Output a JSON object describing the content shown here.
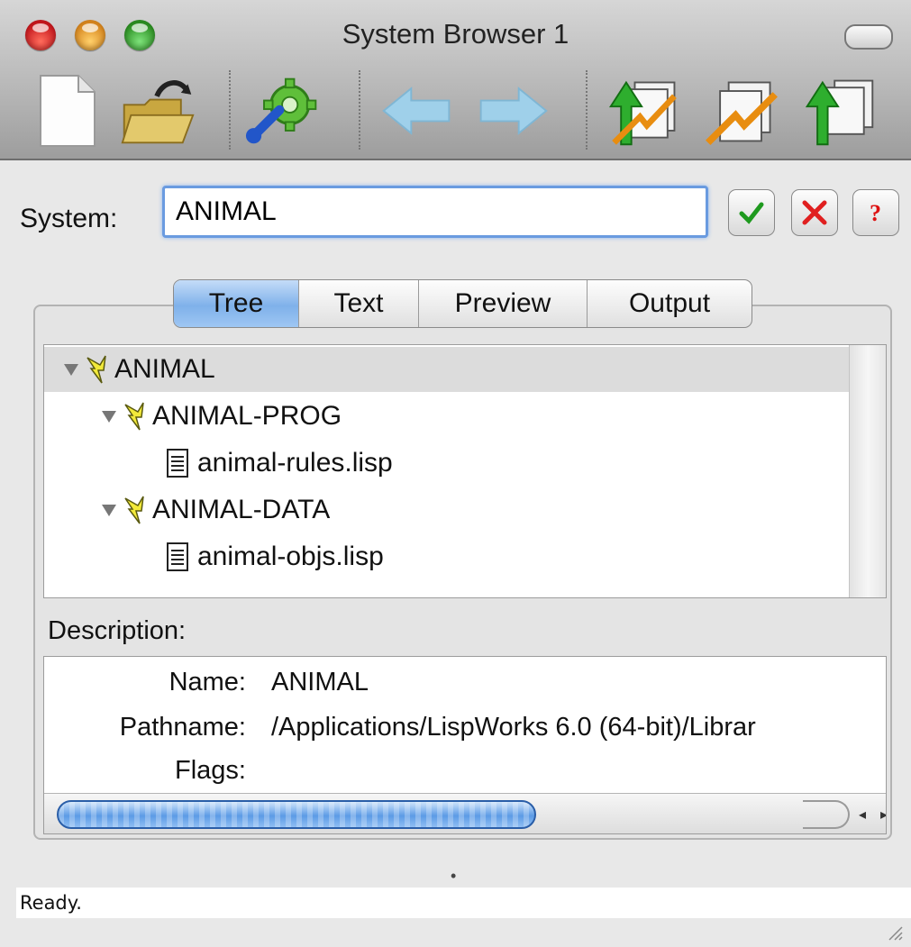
{
  "window": {
    "title": "System Browser 1"
  },
  "toolbar": {
    "buttons": [
      {
        "name": "new-document-icon"
      },
      {
        "name": "open-folder-icon"
      },
      {
        "name": "settings-tools-icon"
      },
      {
        "name": "back-arrow-icon"
      },
      {
        "name": "forward-arrow-icon"
      },
      {
        "name": "load-system-icon"
      },
      {
        "name": "compile-system-icon"
      },
      {
        "name": "upload-files-icon"
      }
    ]
  },
  "system": {
    "label": "System:",
    "value": "ANIMAL",
    "ok_icon": "checkmark-icon",
    "cancel_icon": "x-icon",
    "help_icon": "question-icon"
  },
  "tabs": [
    "Tree",
    "Text",
    "Preview",
    "Output"
  ],
  "active_tab": "Tree",
  "tree": {
    "nodes": [
      {
        "label": "ANIMAL",
        "type": "system",
        "level": 0,
        "expanded": true,
        "selected": true
      },
      {
        "label": "ANIMAL-PROG",
        "type": "system",
        "level": 1,
        "expanded": true
      },
      {
        "label": "animal-rules.lisp",
        "type": "file",
        "level": 2
      },
      {
        "label": "ANIMAL-DATA",
        "type": "system",
        "level": 1,
        "expanded": true
      },
      {
        "label": "animal-objs.lisp",
        "type": "file",
        "level": 2
      }
    ]
  },
  "description": {
    "label": "Description:",
    "rows": [
      {
        "key": "Name:",
        "value": "ANIMAL"
      },
      {
        "key": "Pathname:",
        "value": "/Applications/LispWorks 6.0 (64-bit)/Librar"
      },
      {
        "key": "Flags:",
        "value": ""
      }
    ],
    "hscroll_position": 0.0
  },
  "status": {
    "text": "Ready."
  },
  "colors": {
    "accent": "#6a9be0",
    "selected_row": "#dcdcdc",
    "system_icon_yellow": "#f2e93a"
  }
}
